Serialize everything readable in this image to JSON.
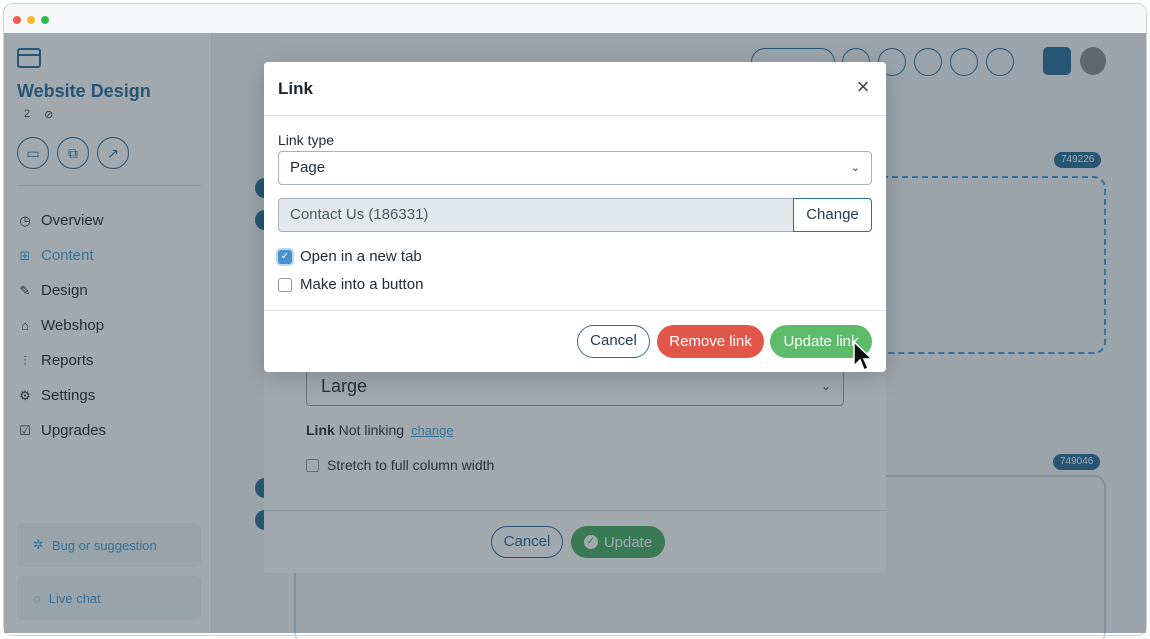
{
  "sidebar": {
    "project_title": "Website Design",
    "meta_count": "2",
    "nav": [
      {
        "label": "Overview",
        "icon": "clock-icon"
      },
      {
        "label": "Content",
        "icon": "layout-icon",
        "active": true
      },
      {
        "label": "Design",
        "icon": "palette-icon"
      },
      {
        "label": "Webshop",
        "icon": "basket-icon"
      },
      {
        "label": "Reports",
        "icon": "chart-icon"
      },
      {
        "label": "Settings",
        "icon": "gear-icon"
      },
      {
        "label": "Upgrades",
        "icon": "calendar-check-icon"
      }
    ],
    "bug_label": "Bug or suggestion",
    "chat_label": "Live chat"
  },
  "canvas": {
    "badge_top": "749226",
    "badge_bottom": "749046"
  },
  "image_dialog": {
    "size_value": "Large",
    "link_label": "Link",
    "link_status": "Not linking",
    "link_change": "change",
    "stretch_label": "Stretch to full column width",
    "cancel_label": "Cancel",
    "update_label": "Update"
  },
  "link_dialog": {
    "title": "Link",
    "close_glyph": "×",
    "link_type_label": "Link type",
    "link_type_value": "Page",
    "page_value": "Contact Us (186331)",
    "change_label": "Change",
    "open_new_tab_label": "Open in a new tab",
    "open_new_tab_checked": true,
    "make_button_label": "Make into a button",
    "make_button_checked": false,
    "cancel_label": "Cancel",
    "remove_label": "Remove link",
    "update_label": "Update link"
  },
  "colors": {
    "brand": "#2d6f9a",
    "accent": "#4a9fd8",
    "danger": "#e0574a",
    "success": "#5dbb6a"
  }
}
